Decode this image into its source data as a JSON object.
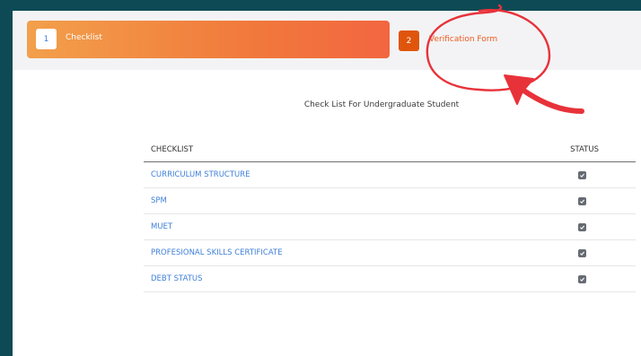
{
  "steps": [
    {
      "number": "1",
      "label": "Checklist"
    },
    {
      "number": "2",
      "label": "Verification Form"
    }
  ],
  "heading": "Check List For Undergraduate Student",
  "table": {
    "headers": {
      "checklist": "CHECKLIST",
      "status": "STATUS"
    },
    "rows": [
      {
        "label": "CURRICULUM STRUCTURE",
        "checked": true
      },
      {
        "label": "SPM",
        "checked": true
      },
      {
        "label": "MUET",
        "checked": true
      },
      {
        "label": "PROFESIONAL SKILLS CERTIFICATE",
        "checked": true
      },
      {
        "label": "DEBT STATUS",
        "checked": true
      }
    ]
  },
  "colors": {
    "background": "#0d4a55",
    "active_step_gradient_start": "#f2a04b",
    "active_step_gradient_end": "#f26640",
    "step2_badge": "#e0550c",
    "link": "#3f7fd9",
    "annotation": "#e8323a"
  },
  "icons": [
    "check-icon",
    "red-circle-annotation",
    "red-arrow-annotation"
  ]
}
